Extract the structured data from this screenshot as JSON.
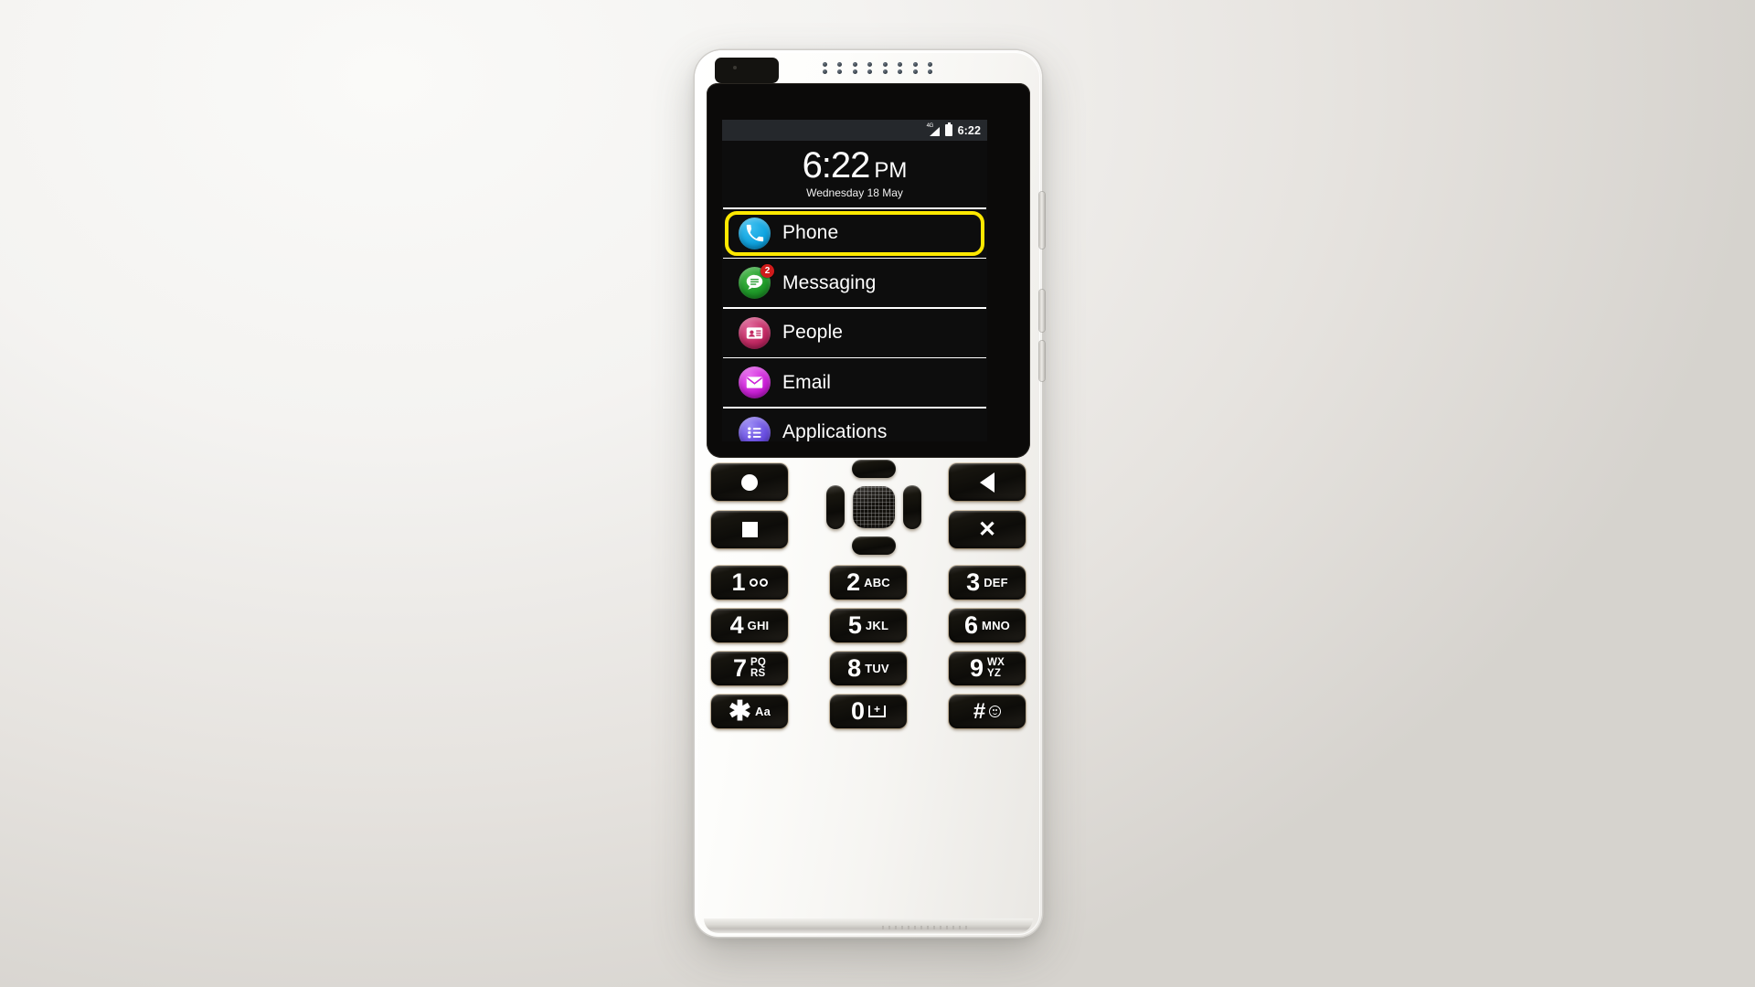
{
  "device": {
    "name": "accessible-feature-phone",
    "body_color": "#ffffff"
  },
  "screen": {
    "status_bar": {
      "signal_label": "4G",
      "signal_icon": "signal-4g-icon",
      "battery_icon": "battery-full-icon",
      "time": "6:22"
    },
    "clock": {
      "time": "6:22",
      "ampm": "PM",
      "date": "Wednesday 18 May"
    },
    "menu": {
      "selection_color": "#ffe800",
      "items": [
        {
          "label": "Phone",
          "icon": "phone-handset-icon",
          "icon_color": "#10a4e0",
          "selected": true,
          "badge": null
        },
        {
          "label": "Messaging",
          "icon": "speech-bubble-icon",
          "icon_color": "#1f9a29",
          "selected": false,
          "badge": "2"
        },
        {
          "label": "People",
          "icon": "contact-card-icon",
          "icon_color": "#c22a63",
          "selected": false,
          "badge": null
        },
        {
          "label": "Email",
          "icon": "envelope-icon",
          "icon_color": "#cc22d8",
          "selected": false,
          "badge": null
        },
        {
          "label": "Applications",
          "icon": "bulleted-list-icon",
          "icon_color": "#6a4fe0",
          "selected": false,
          "badge": null
        }
      ]
    }
  },
  "keypad": {
    "nav_keys": [
      {
        "name": "home-key",
        "glyph": "circle"
      },
      {
        "name": "back-key",
        "glyph": "triangle-left"
      },
      {
        "name": "menu-key",
        "glyph": "square"
      },
      {
        "name": "cancel-key",
        "glyph": "x",
        "label": "✕"
      }
    ],
    "dpad": {
      "up": "dpad-up-key",
      "down": "dpad-down-key",
      "left": "dpad-left-key",
      "right": "dpad-right-key",
      "center": "dpad-select-key"
    },
    "number_keys": [
      {
        "digit": "1",
        "letters": "",
        "extra": "voicemail"
      },
      {
        "digit": "2",
        "letters": "ABC",
        "extra": ""
      },
      {
        "digit": "3",
        "letters": "DEF",
        "extra": ""
      },
      {
        "digit": "4",
        "letters": "GHI",
        "extra": ""
      },
      {
        "digit": "5",
        "letters": "JKL",
        "extra": ""
      },
      {
        "digit": "6",
        "letters": "MNO",
        "extra": ""
      },
      {
        "digit": "7",
        "letters": "PQ\nRS",
        "extra": ""
      },
      {
        "digit": "8",
        "letters": "TUV",
        "extra": ""
      },
      {
        "digit": "9",
        "letters": "WX\nYZ",
        "extra": ""
      },
      {
        "digit": "✱",
        "letters": "Aa",
        "extra": ""
      },
      {
        "digit": "0",
        "letters": "",
        "extra": "plus"
      },
      {
        "digit": "#",
        "letters": "",
        "extra": "smiley"
      }
    ]
  }
}
